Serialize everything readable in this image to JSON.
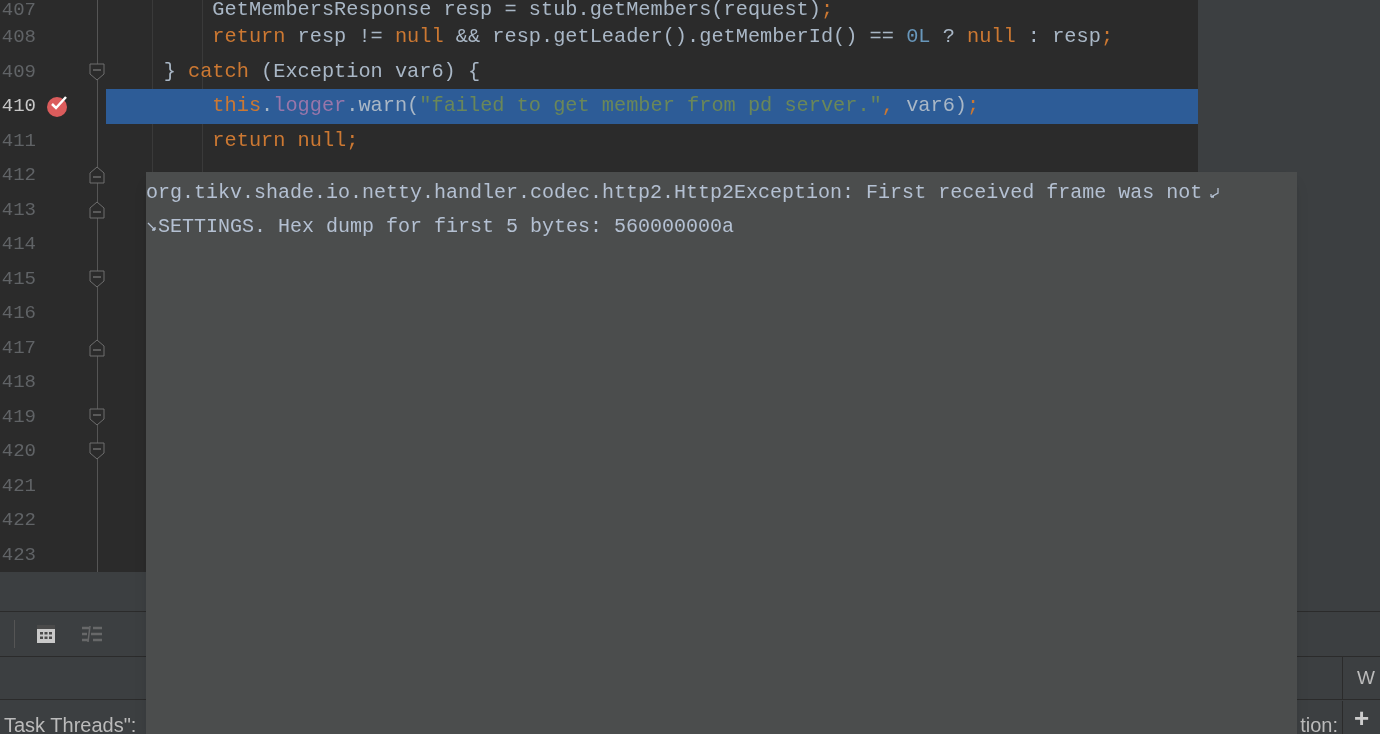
{
  "editor": {
    "lines": [
      {
        "number": "407",
        "breakpoint": false,
        "selected": false,
        "tokens": [
          {
            "kind": "plain",
            "text": "        GetMembersResponse resp = stub.getMembers(request)"
          },
          {
            "kind": "keyword",
            "text": ";"
          }
        ]
      },
      {
        "number": "408",
        "breakpoint": false,
        "selected": false,
        "tokens": [
          {
            "kind": "keyword",
            "text": "        return"
          },
          {
            "kind": "plain",
            "text": " resp != "
          },
          {
            "kind": "keyword",
            "text": "null"
          },
          {
            "kind": "plain",
            "text": " && resp.getLeader().getMemberId() == "
          },
          {
            "kind": "number",
            "text": "0L"
          },
          {
            "kind": "plain",
            "text": " ? "
          },
          {
            "kind": "keyword",
            "text": "null"
          },
          {
            "kind": "plain",
            "text": " : resp"
          },
          {
            "kind": "keyword",
            "text": ";"
          }
        ]
      },
      {
        "number": "409",
        "breakpoint": false,
        "selected": false,
        "fold": {
          "kind": "open"
        },
        "tokens": [
          {
            "kind": "plain",
            "text": "    } "
          },
          {
            "kind": "keyword",
            "text": "catch"
          },
          {
            "kind": "plain",
            "text": " (Exception var6) {"
          }
        ]
      },
      {
        "number": "410",
        "breakpoint": true,
        "selected": true,
        "tokens": [
          {
            "kind": "keyword",
            "text": "        this"
          },
          {
            "kind": "plain",
            "text": "."
          },
          {
            "kind": "field",
            "text": "logger"
          },
          {
            "kind": "plain",
            "text": ".warn("
          },
          {
            "kind": "string",
            "text": "\"failed to get member from pd server.\""
          },
          {
            "kind": "keyword",
            "text": ","
          },
          {
            "kind": "plain",
            "text": " var6)"
          },
          {
            "kind": "keyword",
            "text": ";"
          }
        ]
      },
      {
        "number": "411",
        "breakpoint": false,
        "selected": false,
        "tokens": [
          {
            "kind": "keyword",
            "text": "        return null;"
          }
        ]
      },
      {
        "number": "412",
        "breakpoint": false,
        "selected": false,
        "fold": {
          "kind": "close"
        }
      },
      {
        "number": "413",
        "breakpoint": false,
        "selected": false,
        "fold": {
          "kind": "close"
        }
      },
      {
        "number": "414",
        "breakpoint": false,
        "selected": false
      },
      {
        "number": "415",
        "breakpoint": false,
        "selected": false,
        "fold": {
          "kind": "open"
        }
      },
      {
        "number": "416",
        "breakpoint": false,
        "selected": false
      },
      {
        "number": "417",
        "breakpoint": false,
        "selected": false,
        "fold": {
          "kind": "close"
        }
      },
      {
        "number": "418",
        "breakpoint": false,
        "selected": false
      },
      {
        "number": "419",
        "breakpoint": false,
        "selected": false,
        "fold": {
          "kind": "open"
        }
      },
      {
        "number": "420",
        "breakpoint": false,
        "selected": false,
        "fold": {
          "kind": "open"
        }
      },
      {
        "number": "421",
        "breakpoint": false,
        "selected": false
      },
      {
        "number": "422",
        "breakpoint": false,
        "selected": false
      },
      {
        "number": "423",
        "breakpoint": false,
        "selected": false
      }
    ]
  },
  "tooltip": {
    "lines": [
      "org.tikv.shade.io.netty.handler.codec.http2.Http2Exception: First received frame was not",
      "SETTINGS. Hex dump for first 5 bytes: 560000000a"
    ]
  },
  "bottom_panel": {
    "toolbar": [
      {
        "kind": "table",
        "selected": true
      },
      {
        "kind": "list",
        "selected": false
      }
    ],
    "tab": "W",
    "left_text": "Task Threads\":",
    "right_text": "tion:",
    "add": "+"
  }
}
